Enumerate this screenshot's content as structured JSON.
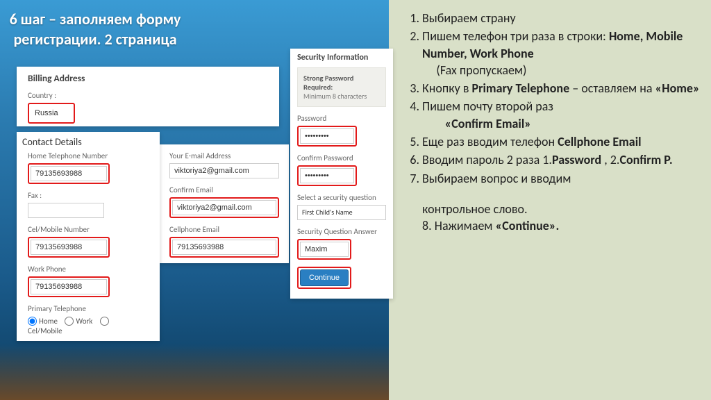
{
  "title": "6 шаг – заполняем форму регистрации. 2 страница",
  "billing": {
    "head": "Billing Address",
    "country_label": "Country :",
    "country_value": "Russia"
  },
  "contact": {
    "head": "Contact Details",
    "home_label": "Home Telephone Number",
    "home_value": "79135693988",
    "fax_label": "Fax :",
    "fax_value": "",
    "cel_label": "Cel/Mobile Number",
    "cel_value": "79135693988",
    "work_label": "Work Phone",
    "work_value": "79135693988",
    "primary_label": "Primary Telephone",
    "radio_home": "Home",
    "radio_work": "Work",
    "radio_cel": "Cel/Mobile"
  },
  "email": {
    "your_label": "Your E-mail Address",
    "your_value": "viktoriya2@gmail.com",
    "confirm_label": "Confirm Email",
    "confirm_value": "viktoriya2@gmail.com",
    "cell_label": "Cellphone Email",
    "cell_value": "79135693988"
  },
  "security": {
    "head": "Security Information",
    "info_strong": "Strong Password Required:",
    "info_text": "Minimum 8 characters",
    "pw_label": "Password",
    "pw_value": "•••••••••",
    "cpw_label": "Confirm Password",
    "cpw_value": "•••••••••",
    "sq_label": "Select a security question",
    "sq_value": "First Child's Name",
    "sqa_label": "Security Question Answer",
    "sqa_value": "Maxim",
    "continue": "Continue"
  },
  "instr": {
    "i1": "Выбираем  страну",
    "i2a": "Пишем телефон три раза в строки: ",
    "i2b": "Home, Mobile Number, Work Phone",
    "i2c": "(Fax пропускаем)",
    "i3a": "Кнопку в ",
    "i3b": "Primary Telephone",
    "i3c": " – оставляем на ",
    "i3d": "«Home»",
    "i4a": "Пишем  почту второй раз",
    "i4b": "«Confirm Email»",
    "i5a": "Еще раз вводим телефон ",
    "i5b": "Cellphone Email",
    "i6a": "Вводим пароль 2 раза 1.",
    "i6b": "Password",
    "i6c": " , 2.",
    "i6d": "Confirm P.",
    "i7": "Выбираем  вопрос и вводим",
    "tail1": "контрольное слово.",
    "tail2a": "8. Нажимаем  ",
    "tail2b": "«Continue»."
  }
}
